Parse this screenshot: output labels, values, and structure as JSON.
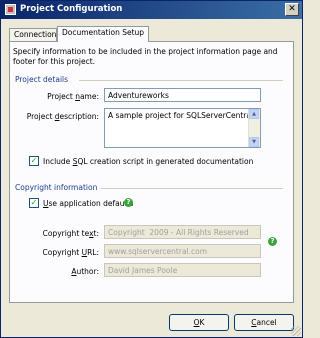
{
  "window": {
    "title": "Project Configuration",
    "close_glyph": "✕"
  },
  "tabs": [
    {
      "label": "Connection",
      "active": false
    },
    {
      "label": "Documentation Setup",
      "active": true
    }
  ],
  "description": "Specify information to be included in the project information page and footer for this project.",
  "project_details": {
    "group_label": "Project details",
    "name_label_pre": "Project ",
    "name_label_acc": "n",
    "name_label_post": "ame:",
    "name_value": "Adventureworks",
    "desc_label_pre": "Project ",
    "desc_label_acc": "d",
    "desc_label_post": "escription:",
    "desc_value": "A sample project for SQLServerCentral",
    "sql_checkbox_pre": "Include ",
    "sql_checkbox_acc": "S",
    "sql_checkbox_post": "QL creation script in generated documentation",
    "sql_checked": true
  },
  "copyright": {
    "group_label": "Copyright information",
    "use_defaults_acc": "U",
    "use_defaults_post": "se application defaults",
    "use_defaults_checked": true,
    "text_label_pre": "Copyright te",
    "text_label_acc": "x",
    "text_label_post": "t:",
    "text_value": "Copyright  2009 - All Rights Reserved",
    "url_label_pre": "Copyright ",
    "url_label_acc": "U",
    "url_label_post": "RL:",
    "url_value": "www.sqlservercentral.com",
    "author_label_acc": "A",
    "author_label_post": "uthor:",
    "author_value": "David James Poole"
  },
  "buttons": {
    "ok_acc": "O",
    "ok_post": "K",
    "cancel_acc": "C",
    "cancel_post": "ancel"
  },
  "icons": {
    "check_glyph": "✓",
    "help_glyph": "?",
    "up_glyph": "▲",
    "down_glyph": "▼"
  },
  "colors": {
    "title_bar": "#0a246a",
    "group_label": "#1a3d8f",
    "help_icon": "#3aa53a"
  }
}
